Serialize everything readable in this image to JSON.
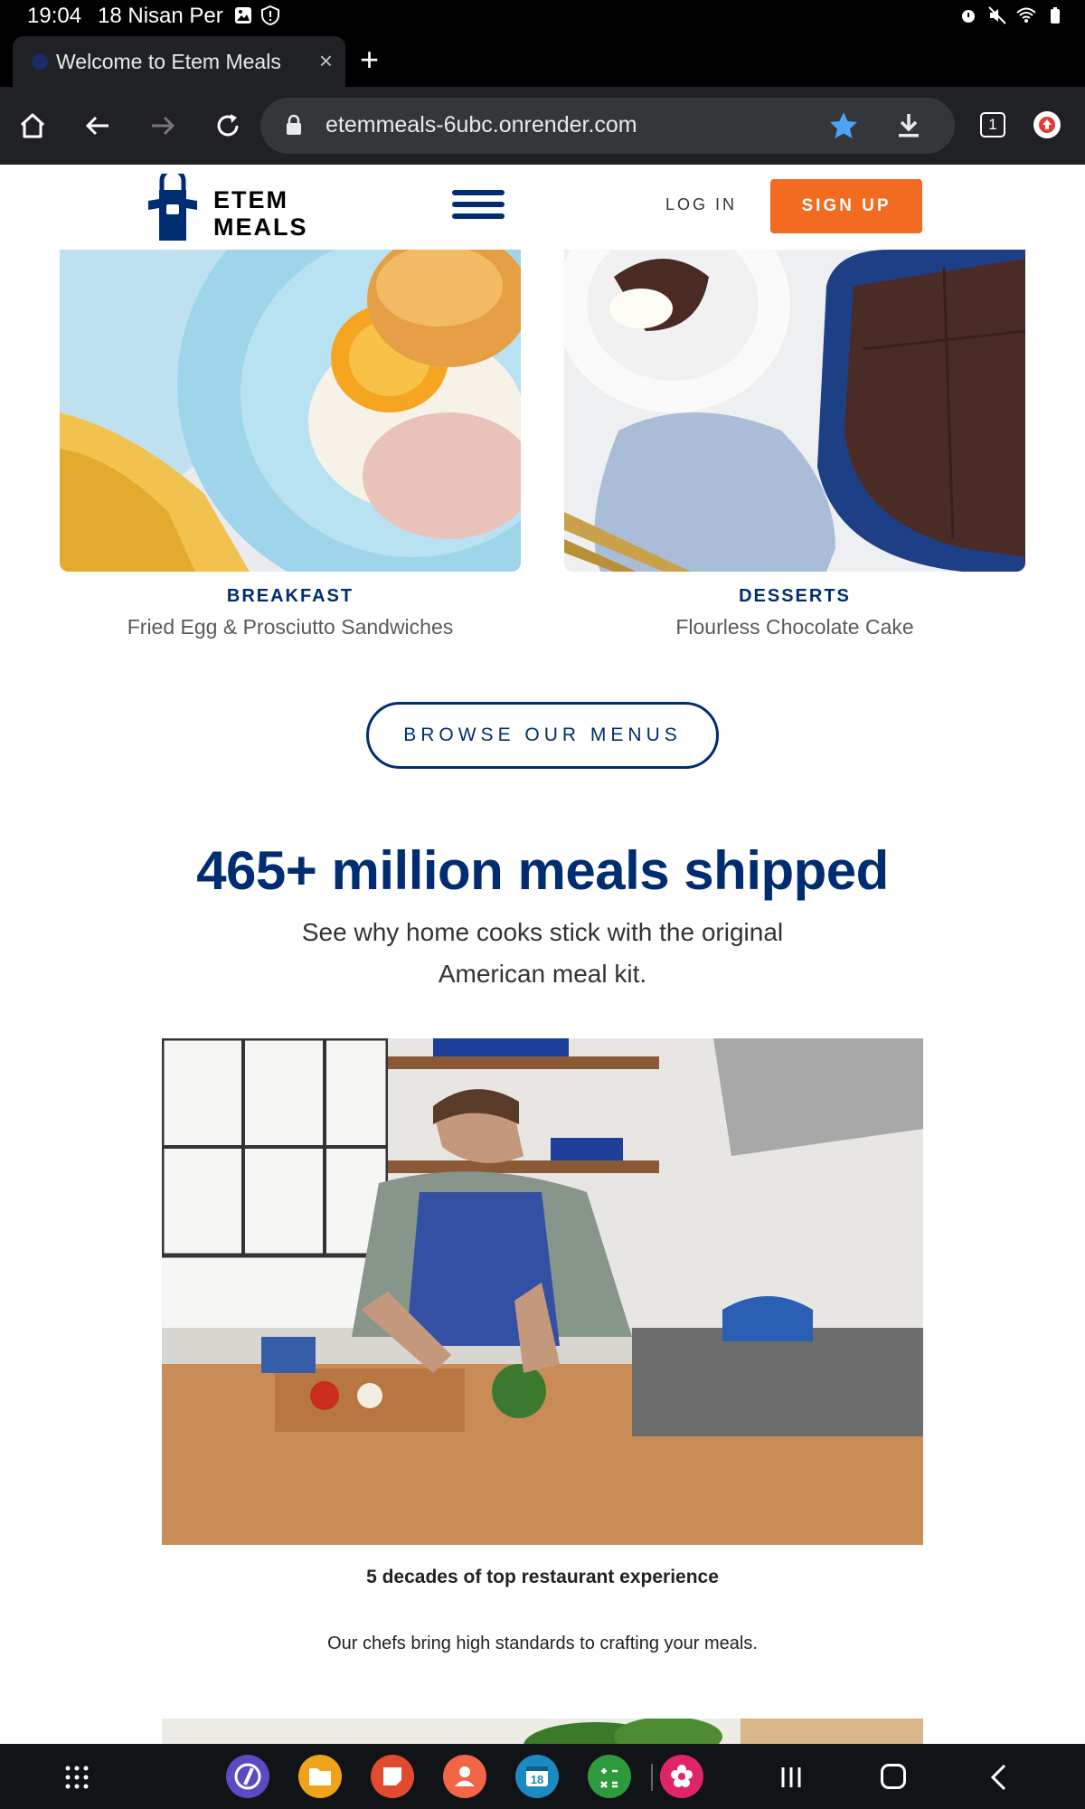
{
  "status_bar": {
    "time": "19:04",
    "date": "18 Nisan Per"
  },
  "browser": {
    "tab_title": "Welcome to Etem Meals",
    "tab_close": "×",
    "new_tab": "+",
    "url": "etemmeals-6ubc.onrender.com",
    "tab_count": "1",
    "star_color": "#4da3f7",
    "accent_color": "#e53935"
  },
  "site": {
    "logo_line1": "ETEM",
    "logo_line2": "MEALS",
    "login": "LOG IN",
    "signup": "SIGN UP",
    "brand_blue": "#002d72",
    "brand_orange": "#f26b21"
  },
  "recipes": [
    {
      "category": "BREAKFAST",
      "title": "Fried Egg & Prosciutto Sandwiches"
    },
    {
      "category": "DESSERTS",
      "title": "Flourless Chocolate Cake"
    }
  ],
  "browse_button": "BROWSE OUR MENUS",
  "stats": {
    "headline": "465+ million meals shipped",
    "subline": "See why home cooks stick with the original American meal kit."
  },
  "feature": {
    "title": "5 decades of top restaurant experience",
    "text": "Our chefs bring high standards to crafting your meals."
  },
  "dock": {
    "calendar_day": "18",
    "apps": [
      "compass-icon",
      "files-icon",
      "notes-icon",
      "contacts-icon",
      "calendar-icon",
      "calculator-icon",
      "gallery-icon"
    ]
  }
}
